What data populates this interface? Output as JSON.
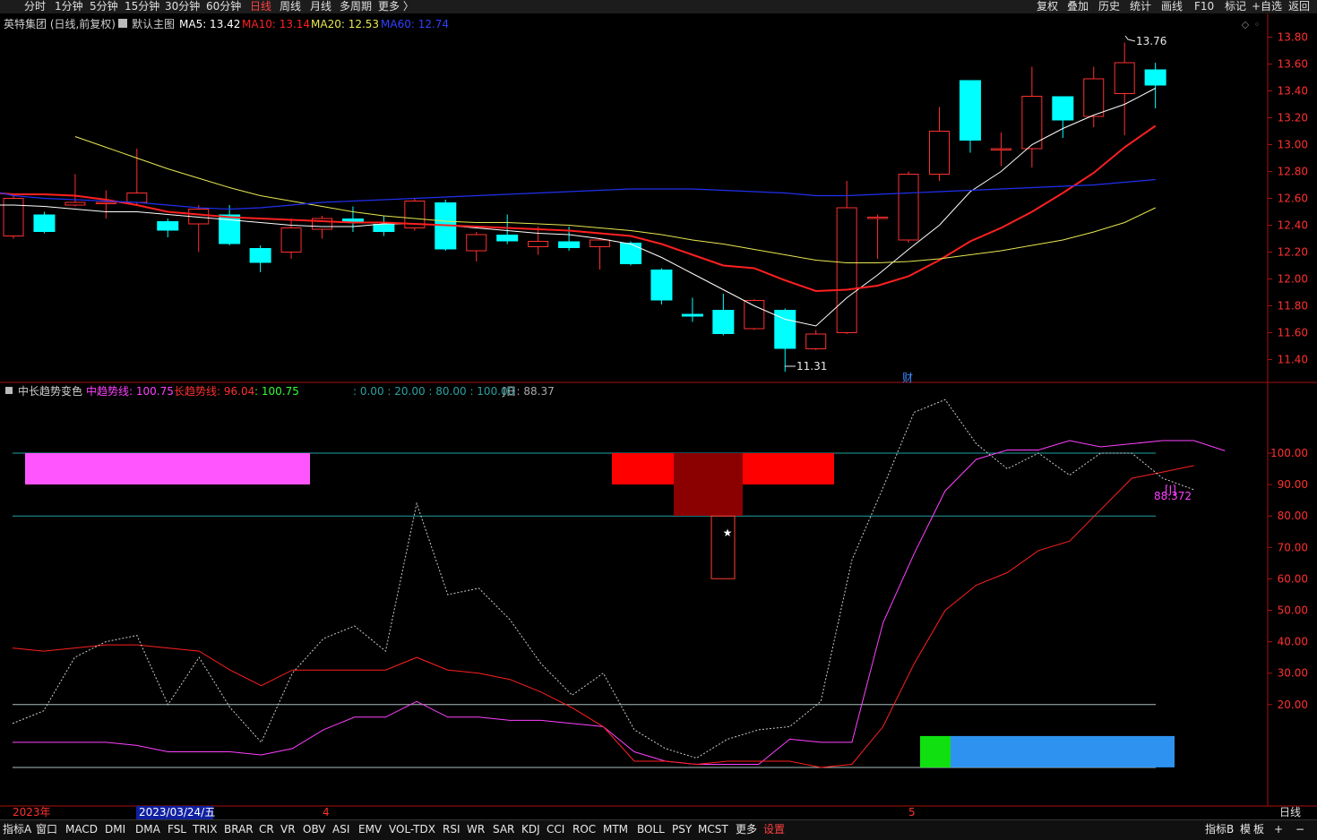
{
  "toolbar": {
    "periods": [
      "分时",
      "1分钟",
      "5分钟",
      "15分钟",
      "30分钟",
      "60分钟",
      "日线",
      "周线",
      "月线",
      "多周期",
      "更多 〉"
    ],
    "active_period": "日线",
    "right_buttons": [
      "复权",
      "叠加",
      "历史",
      "统计",
      "画线",
      "F10",
      "标记",
      "+自选",
      "返回"
    ]
  },
  "main_panel": {
    "stock_name": "英特集团",
    "period_label": "(日线,前复权)",
    "template_label": "默认主图",
    "ma": [
      {
        "label": "MA5: 13.42",
        "color": "#ffffff"
      },
      {
        "label": "MA10: 13.14",
        "color": "#ff2020"
      },
      {
        "label": "MA20: 12.53",
        "color": "#e8e850"
      },
      {
        "label": "MA60: 12.74",
        "color": "#3040ff"
      }
    ],
    "y_ticks": [
      "13.80",
      "13.60",
      "13.40",
      "13.20",
      "13.00",
      "12.80",
      "12.60",
      "12.40",
      "12.20",
      "12.00",
      "11.80",
      "11.60",
      "11.40"
    ],
    "high_label": "13.76",
    "low_label": "11.31",
    "fin_marker": "财"
  },
  "indicator_panel": {
    "name": "中长趋势变色",
    "mid_line": "中趋势线: 100.75",
    "long_line": "长趋势线: 96.04",
    "third_value": ": 100.75",
    "levels": ": 0.00 : 20.00 : 80.00 : 100.00",
    "j_label": "J日: 88.37",
    "y_ticks": [
      "100.00",
      "90.00",
      "80.00",
      "70.00",
      "60.00",
      "50.00",
      "40.00",
      "30.00",
      "20.00"
    ],
    "marker_label": "[J]",
    "marker_value": "88.372",
    "star": "★"
  },
  "x_axis": {
    "year": "2023年",
    "cursor_date": "2023/03/24/五",
    "month_4": "4",
    "month_5": "5",
    "period": "日线"
  },
  "bottom_tabs": {
    "left_label": "指标A",
    "tabs": [
      "窗口",
      "MACD",
      "DMI",
      "DMA",
      "FSL",
      "TRIX",
      "BRAR",
      "CR",
      "VR",
      "OBV",
      "ASI",
      "EMV",
      "VOL-TDX",
      "RSI",
      "WR",
      "SAR",
      "KDJ",
      "CCI",
      "ROC",
      "MTM",
      "BOLL",
      "PSY",
      "MCST",
      "更多",
      "设置"
    ],
    "right_labels": [
      "指标B",
      "模",
      "板",
      "+",
      "−"
    ]
  },
  "chart_data": [
    {
      "type": "candlestick",
      "title": "英特集团 (日线,前复权)",
      "ylim": [
        11.25,
        13.85
      ],
      "candles": [
        {
          "o": 12.32,
          "h": 12.62,
          "l": 12.3,
          "c": 12.6
        },
        {
          "o": 12.48,
          "h": 12.5,
          "l": 12.34,
          "c": 12.35
        },
        {
          "o": 12.55,
          "h": 12.78,
          "l": 12.54,
          "c": 12.57
        },
        {
          "o": 12.56,
          "h": 12.66,
          "l": 12.45,
          "c": 12.57
        },
        {
          "o": 12.57,
          "h": 12.97,
          "l": 12.55,
          "c": 12.64
        },
        {
          "o": 12.43,
          "h": 12.45,
          "l": 12.31,
          "c": 12.36
        },
        {
          "o": 12.41,
          "h": 12.55,
          "l": 12.2,
          "c": 12.52
        },
        {
          "o": 12.48,
          "h": 12.55,
          "l": 12.25,
          "c": 12.26
        },
        {
          "o": 12.23,
          "h": 12.25,
          "l": 12.05,
          "c": 12.12
        },
        {
          "o": 12.2,
          "h": 12.45,
          "l": 12.15,
          "c": 12.38
        },
        {
          "o": 12.37,
          "h": 12.47,
          "l": 12.3,
          "c": 12.45
        },
        {
          "o": 12.45,
          "h": 12.54,
          "l": 12.35,
          "c": 12.42
        },
        {
          "o": 12.41,
          "h": 12.47,
          "l": 12.32,
          "c": 12.35
        },
        {
          "o": 12.38,
          "h": 12.6,
          "l": 12.36,
          "c": 12.58
        },
        {
          "o": 12.57,
          "h": 12.59,
          "l": 12.21,
          "c": 12.22
        },
        {
          "o": 12.21,
          "h": 12.35,
          "l": 12.13,
          "c": 12.33
        },
        {
          "o": 12.33,
          "h": 12.48,
          "l": 12.26,
          "c": 12.28
        },
        {
          "o": 12.24,
          "h": 12.39,
          "l": 12.18,
          "c": 12.28
        },
        {
          "o": 12.28,
          "h": 12.39,
          "l": 12.21,
          "c": 12.23
        },
        {
          "o": 12.24,
          "h": 12.3,
          "l": 12.07,
          "c": 12.29
        },
        {
          "o": 12.27,
          "h": 12.28,
          "l": 12.1,
          "c": 12.11
        },
        {
          "o": 12.07,
          "h": 12.08,
          "l": 11.81,
          "c": 11.84
        },
        {
          "o": 11.74,
          "h": 11.86,
          "l": 11.68,
          "c": 11.72
        },
        {
          "o": 11.77,
          "h": 11.89,
          "l": 11.58,
          "c": 11.59
        },
        {
          "o": 11.63,
          "h": 11.85,
          "l": 11.62,
          "c": 11.84
        },
        {
          "o": 11.77,
          "h": 11.78,
          "l": 11.31,
          "c": 11.48
        },
        {
          "o": 11.48,
          "h": 11.62,
          "l": 11.47,
          "c": 11.59
        },
        {
          "o": 11.6,
          "h": 12.73,
          "l": 11.59,
          "c": 12.53
        },
        {
          "o": 12.45,
          "h": 12.48,
          "l": 12.15,
          "c": 12.46
        },
        {
          "o": 12.29,
          "h": 12.8,
          "l": 12.27,
          "c": 12.78
        },
        {
          "o": 12.78,
          "h": 13.28,
          "l": 12.73,
          "c": 13.1
        },
        {
          "o": 13.48,
          "h": 13.48,
          "l": 12.94,
          "c": 13.03
        },
        {
          "o": 12.96,
          "h": 13.09,
          "l": 12.84,
          "c": 12.97
        },
        {
          "o": 12.97,
          "h": 13.58,
          "l": 12.83,
          "c": 13.36
        },
        {
          "o": 13.36,
          "h": 13.36,
          "l": 13.05,
          "c": 13.18
        },
        {
          "o": 13.21,
          "h": 13.58,
          "l": 13.13,
          "c": 13.49
        },
        {
          "o": 13.38,
          "h": 13.76,
          "l": 13.07,
          "c": 13.61
        },
        {
          "o": 13.56,
          "h": 13.61,
          "l": 13.27,
          "c": 13.44
        }
      ],
      "ma": {
        "MA5": [
          12.55,
          12.55,
          12.54,
          12.52,
          12.5,
          12.5,
          12.48,
          12.46,
          12.44,
          12.42,
          12.4,
          12.39,
          12.39,
          12.41,
          12.41,
          12.4,
          12.38,
          12.36,
          12.34,
          12.33,
          12.3,
          12.26,
          12.16,
          12.04,
          11.92,
          11.8,
          11.7,
          11.65,
          11.86,
          12.03,
          12.22,
          12.4,
          12.65,
          12.8,
          13.0,
          13.12,
          13.22,
          13.3,
          13.42
        ],
        "MA10": [
          12.65,
          12.63,
          12.63,
          12.62,
          12.59,
          12.55,
          12.5,
          12.48,
          12.46,
          12.45,
          12.44,
          12.43,
          12.42,
          12.42,
          12.41,
          12.4,
          12.39,
          12.38,
          12.37,
          12.36,
          12.34,
          12.32,
          12.26,
          12.18,
          12.1,
          12.08,
          11.99,
          11.91,
          11.92,
          11.95,
          12.02,
          12.14,
          12.28,
          12.38,
          12.5,
          12.64,
          12.79,
          12.98,
          13.14
        ],
        "MA20": [
          13.06,
          12.98,
          12.9,
          12.82,
          12.75,
          12.68,
          12.62,
          12.58,
          12.54,
          12.5,
          12.47,
          12.45,
          12.43,
          12.42,
          12.42,
          12.41,
          12.4,
          12.38,
          12.36,
          12.33,
          12.29,
          12.26,
          12.22,
          12.18,
          12.14,
          12.12,
          12.12,
          12.13,
          12.15,
          12.18,
          12.21,
          12.25,
          12.29,
          12.35,
          12.42,
          12.53
        ],
        "MA60": [
          12.67,
          12.62,
          12.6,
          12.59,
          12.58,
          12.57,
          12.55,
          12.53,
          12.52,
          12.53,
          12.55,
          12.57,
          12.58,
          12.59,
          12.6,
          12.61,
          12.62,
          12.63,
          12.64,
          12.65,
          12.66,
          12.67,
          12.67,
          12.67,
          12.66,
          12.65,
          12.64,
          12.62,
          12.62,
          12.63,
          12.64,
          12.65,
          12.66,
          12.67,
          12.68,
          12.69,
          12.7,
          12.72,
          12.74
        ]
      }
    },
    {
      "type": "line",
      "title": "中长趋势变色",
      "ylim": [
        0,
        120
      ],
      "series": [
        {
          "name": "中趋势线",
          "values": [
            8,
            8,
            8,
            8,
            7,
            5,
            5,
            5,
            4,
            6,
            12,
            16,
            16,
            21,
            16,
            16,
            15,
            15,
            14,
            13,
            5,
            2,
            1,
            1,
            1,
            9,
            8,
            8,
            46,
            68,
            88,
            98,
            101,
            101,
            104,
            102,
            103,
            104,
            104,
            100.75
          ]
        },
        {
          "name": "长趋势线",
          "values": [
            38,
            37,
            38,
            39,
            39,
            38,
            37,
            31,
            26,
            31,
            31,
            31,
            31,
            35,
            31,
            30,
            28,
            24,
            19,
            13,
            2,
            2,
            1,
            2,
            2,
            2,
            0,
            1,
            13,
            33,
            50,
            58,
            62,
            69,
            72,
            82,
            92,
            94,
            96.04
          ]
        },
        {
          "name": "J",
          "values": [
            14,
            18,
            35,
            40,
            42,
            20,
            35,
            19,
            8,
            30,
            41,
            45,
            37,
            84,
            55,
            57,
            47,
            33,
            23,
            30,
            12,
            6,
            3,
            9,
            12,
            13,
            21,
            66,
            89,
            113,
            117,
            103,
            95,
            100,
            93,
            100,
            100,
            92,
            88.37
          ]
        }
      ]
    }
  ]
}
